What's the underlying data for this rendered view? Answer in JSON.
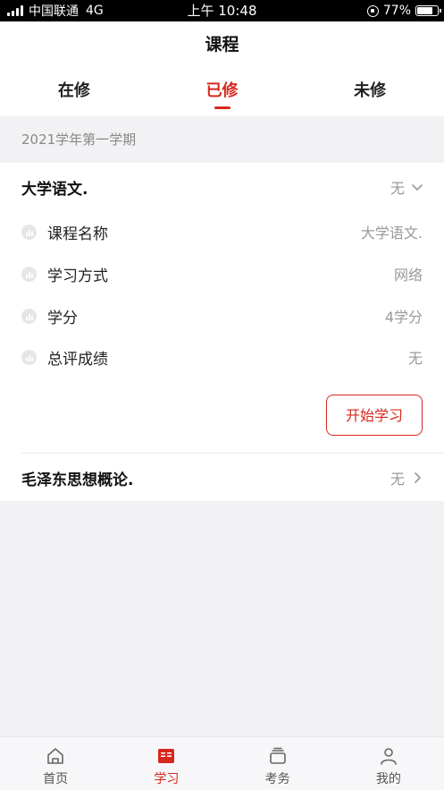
{
  "status_bar": {
    "carrier": "中国联通",
    "network": "4G",
    "time": "上午 10:48",
    "battery": "77%",
    "battery_level": 0.77
  },
  "header": {
    "title": "课程"
  },
  "tabs": [
    {
      "label": "在修",
      "active": false
    },
    {
      "label": "已修",
      "active": true
    },
    {
      "label": "未修",
      "active": false
    }
  ],
  "semester": "2021学年第一学期",
  "courses": [
    {
      "title": "大学语文.",
      "status": "无",
      "expanded": true,
      "details": [
        {
          "label": "课程名称",
          "value": "大学语文."
        },
        {
          "label": "学习方式",
          "value": "网络"
        },
        {
          "label": "学分",
          "value": "4学分"
        },
        {
          "label": "总评成绩",
          "value": "无"
        }
      ],
      "action_label": "开始学习"
    },
    {
      "title": "毛泽东思想概论.",
      "status": "无",
      "expanded": false
    }
  ],
  "bottom_nav": [
    {
      "label": "首页",
      "icon": "home-icon",
      "active": false
    },
    {
      "label": "学习",
      "icon": "book-icon",
      "active": true
    },
    {
      "label": "考务",
      "icon": "stack-icon",
      "active": false
    },
    {
      "label": "我的",
      "icon": "person-icon",
      "active": false
    }
  ],
  "colors": {
    "accent": "#d6281f",
    "background": "#f2f2f4",
    "muted_text": "#999999"
  }
}
